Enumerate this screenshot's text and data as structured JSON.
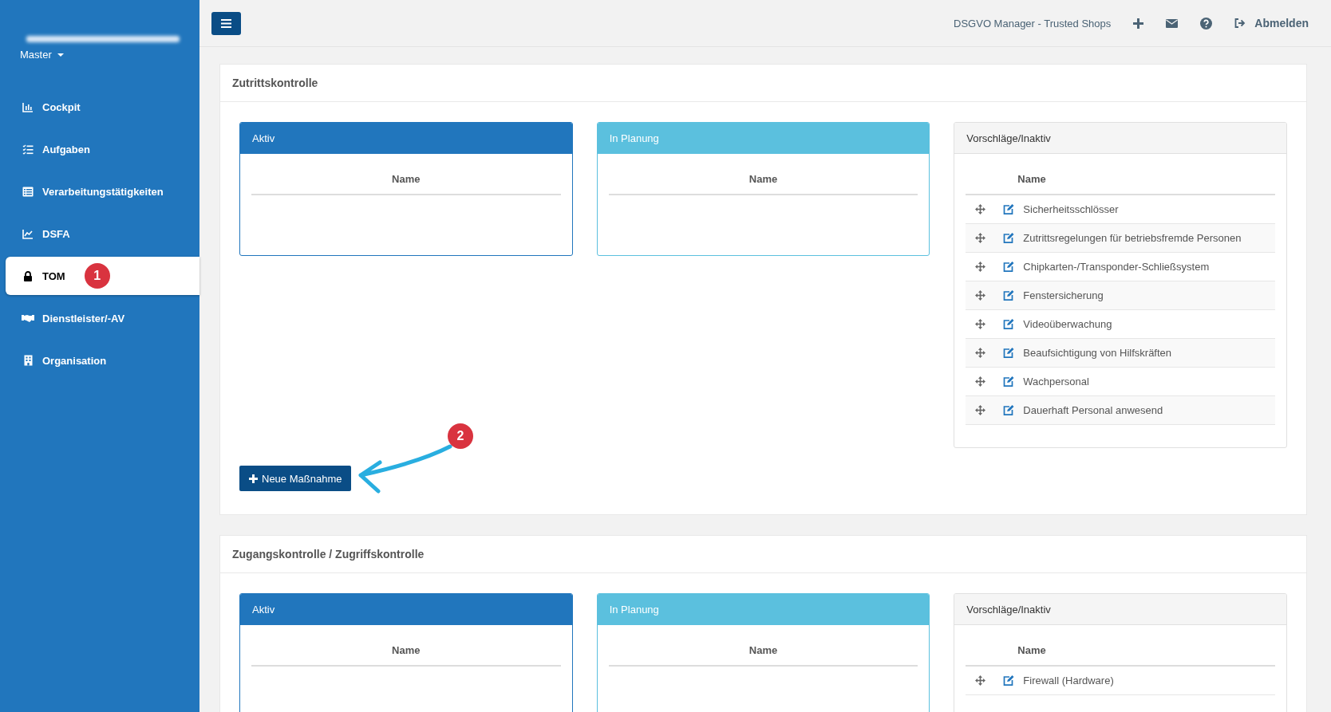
{
  "sidebar": {
    "account": {
      "label": "Master"
    },
    "items": [
      {
        "label": "Cockpit",
        "selected": false
      },
      {
        "label": "Aufgaben",
        "selected": false
      },
      {
        "label": "Verarbeitungstätigkeiten",
        "selected": false
      },
      {
        "label": "DSFA",
        "selected": false
      },
      {
        "label": "TOM",
        "selected": true,
        "annotation": "1"
      },
      {
        "label": "Dienstleister/-AV",
        "selected": false
      },
      {
        "label": "Organisation",
        "selected": false
      }
    ]
  },
  "header": {
    "title": "DSGVO Manager - Trusted Shops",
    "logout": "Abmelden"
  },
  "sections": [
    {
      "title": "Zutrittskontrolle",
      "button": "Neue Maßnahme",
      "annotation": "2",
      "panels": [
        {
          "kind": "active",
          "title": "Aktiv",
          "column": "Name"
        },
        {
          "kind": "planned",
          "title": "In Planung",
          "column": "Name"
        },
        {
          "kind": "suggestions",
          "title": "Vorschläge/Inaktiv",
          "column": "Name",
          "rows": [
            "Sicherheitsschlösser",
            "Zutrittsregelungen für betriebsfremde Personen",
            "Chipkarten-/Transponder-Schließsystem",
            "Fenstersicherung",
            "Videoüberwachung",
            "Beaufsichtigung von Hilfskräften",
            "Wachpersonal",
            "Dauerhaft Personal anwesend"
          ]
        }
      ]
    },
    {
      "title": "Zugangskontrolle / Zugriffskontrolle",
      "panels": [
        {
          "kind": "active",
          "title": "Aktiv",
          "column": "Name"
        },
        {
          "kind": "planned",
          "title": "In Planung",
          "column": "Name"
        },
        {
          "kind": "suggestions",
          "title": "Vorschläge/Inaktiv",
          "column": "Name",
          "rows": [
            "Firewall (Hardware)"
          ]
        }
      ]
    }
  ]
}
